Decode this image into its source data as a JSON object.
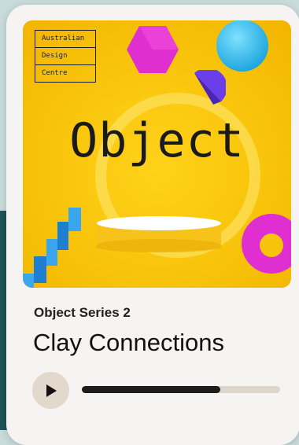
{
  "brand": {
    "lines": [
      "Australian",
      "Design",
      "Centre"
    ]
  },
  "artwork": {
    "title": "Object"
  },
  "episode": {
    "series": "Object Series 2",
    "title": "Clay Connections"
  },
  "player": {
    "progress": 0.7
  },
  "colors": {
    "artwork_background": "#f8c40b",
    "magenta": "#e02fd0",
    "cyan": "#3cc3f0",
    "purple": "#6a3ee8",
    "progress_fill": "#1c1c1c",
    "play_button": "#e3d8cc"
  },
  "icons": {
    "play": "play-icon"
  }
}
